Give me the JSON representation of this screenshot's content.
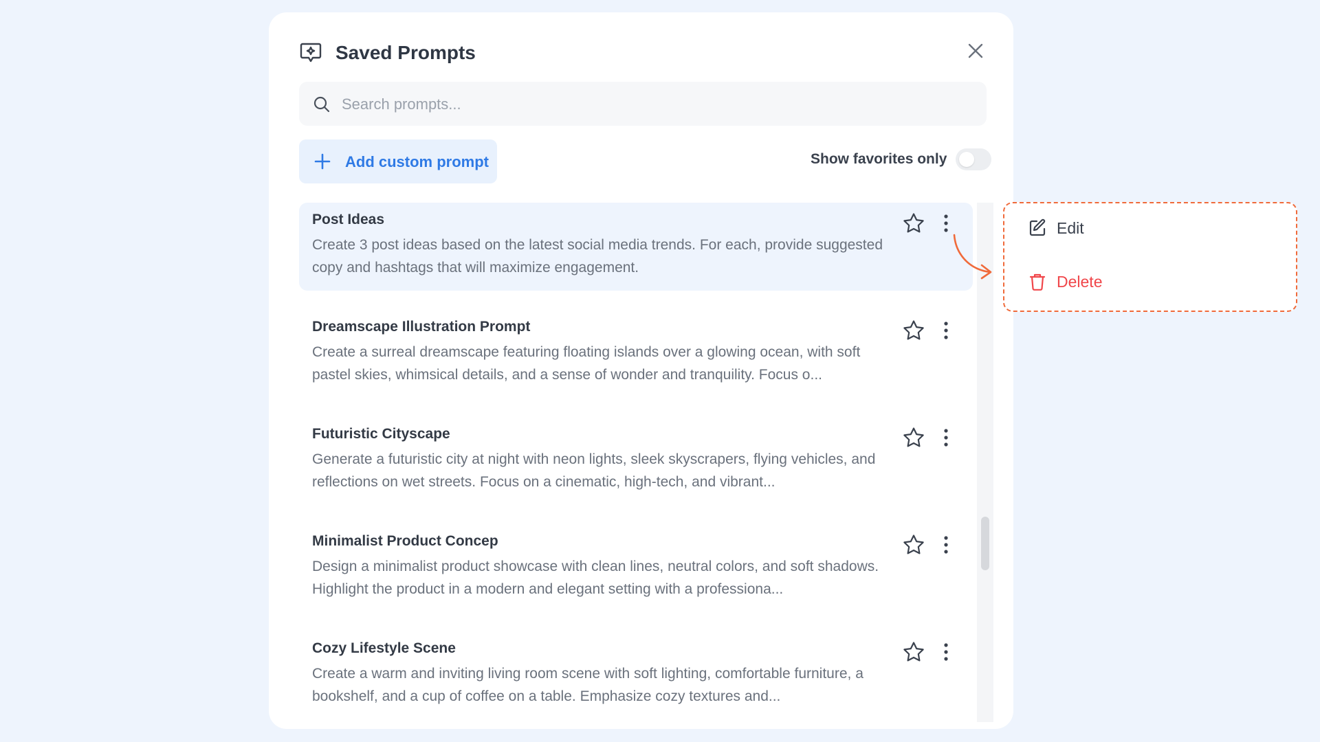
{
  "modal": {
    "title": "Saved Prompts",
    "search_placeholder": "Search prompts...",
    "add_button_label": "Add custom prompt",
    "favorites_label": "Show favorites only"
  },
  "prompts": [
    {
      "title": "Post Ideas",
      "description": "Create 3 post ideas based on the latest social media trends. For each, provide suggested copy and hashtags that will maximize engagement."
    },
    {
      "title": "Dreamscape Illustration Prompt",
      "description": "Create a surreal dreamscape featuring floating islands over a glowing ocean, with soft pastel skies, whimsical details, and a sense of wonder and tranquility. Focus o..."
    },
    {
      "title": "Futuristic Cityscape",
      "description": "Generate a futuristic city at night with neon lights, sleek skyscrapers, flying vehicles, and reflections on wet streets. Focus on a cinematic, high-tech, and vibrant..."
    },
    {
      "title": "Minimalist Product Concep",
      "description": "Design a minimalist product showcase with clean lines, neutral colors, and soft shadows. Highlight the product in a modern and elegant setting with a professiona..."
    },
    {
      "title": "Cozy Lifestyle Scene",
      "description": "Create a warm and inviting living room scene with soft lighting, comfortable furniture, a bookshelf, and a cup of coffee on a table. Emphasize cozy textures and..."
    }
  ],
  "context_menu": {
    "edit_label": "Edit",
    "delete_label": "Delete"
  },
  "colors": {
    "background": "#eef4fd",
    "accent": "#2f7ae5",
    "danger": "#f0464a",
    "annotation": "#f06a3a"
  },
  "icons": [
    "prompt-icon",
    "close-icon",
    "search-icon",
    "plus-icon",
    "star-icon",
    "more-vertical-icon",
    "edit-icon",
    "trash-icon",
    "arrow-icon"
  ]
}
